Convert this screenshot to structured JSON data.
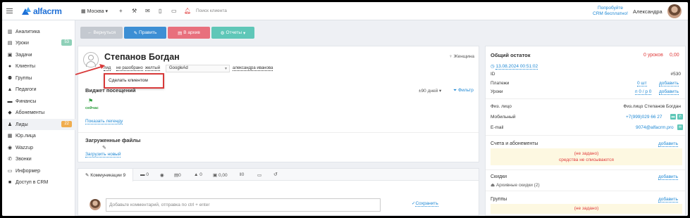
{
  "topbar": {
    "branch": "Москва",
    "search_placeholder": "Поиск клиента",
    "promo_line1": "Попробуйте",
    "promo_line2": "CRM бесплатно!",
    "user": "Александра"
  },
  "brand": {
    "name": "alfacrm",
    "accent": "#1e6fd6"
  },
  "sidebar": {
    "items": [
      {
        "icon": "chart-icon",
        "label": "Аналитика",
        "badge": ""
      },
      {
        "icon": "calendar-icon",
        "label": "Уроки",
        "badge": "53"
      },
      {
        "icon": "tasks-icon",
        "label": "Задачи",
        "badge": ""
      },
      {
        "icon": "user-icon",
        "label": "Клиенты",
        "badge": ""
      },
      {
        "icon": "group-icon",
        "label": "Группы",
        "badge": ""
      },
      {
        "icon": "graduation-cap-icon",
        "label": "Педагоги",
        "badge": ""
      },
      {
        "icon": "money-icon",
        "label": "Финансы",
        "badge": ""
      },
      {
        "icon": "tag-icon",
        "label": "Абонементы",
        "badge": ""
      },
      {
        "icon": "user-plus-icon",
        "label": "Лиды",
        "badge": "22"
      },
      {
        "icon": "building-icon",
        "label": "Юр.лица",
        "badge": ""
      },
      {
        "icon": "whatsapp-icon",
        "label": "Wazzup",
        "badge": ""
      },
      {
        "icon": "phone-icon",
        "label": "Звонки",
        "badge": ""
      },
      {
        "icon": "monitor-icon",
        "label": "Информер",
        "badge": ""
      },
      {
        "icon": "lock-icon",
        "label": "Доступ в CRM",
        "badge": ""
      }
    ]
  },
  "actions": {
    "back": "Вернуться",
    "edit": "Править",
    "archive": "В архив",
    "reports": "Отчеты"
  },
  "profile": {
    "name": "Степанов Богдан",
    "gender": "Женщина",
    "tag1": "лид",
    "tag2": "не разобрано",
    "tag3": "желтый",
    "source": "GoogleAd",
    "manager": "александра иванова",
    "dropdown_item": "Сделать клиентом"
  },
  "widget": {
    "title": "Виджет посещений",
    "days": "±90 дней",
    "filter": "Фильтр",
    "now": "сейчас",
    "legend": "Показать легенду"
  },
  "files": {
    "title": "Загруженные файлы",
    "upload": "Загрузить новый"
  },
  "tabs": [
    {
      "icon": "comments-icon",
      "label": "Коммуникации 9"
    },
    {
      "icon": "message-icon",
      "label": "0"
    },
    {
      "icon": "whatsapp-icon",
      "label": ""
    },
    {
      "icon": "document-icon",
      "label": "0"
    },
    {
      "icon": "shopping-bag-icon",
      "label": "0"
    },
    {
      "icon": "wallet-icon",
      "label": "0,00"
    },
    {
      "icon": "pause-icon",
      "label": "0"
    },
    {
      "icon": "ticket-icon",
      "label": ""
    },
    {
      "icon": "history-icon",
      "label": ""
    }
  ],
  "comment": {
    "placeholder": "Добавьте комментарий, отправка по ctrl + enter",
    "save": "Сохранить"
  },
  "balance": {
    "title": "Общий остаток",
    "lessons": "0 уроков",
    "amount": "0,00",
    "date": "13.08.2024 00:51:02",
    "id_label": "ID",
    "id_value": "#530",
    "payments_label": "Платежи",
    "payments_value": "0 шт",
    "payments_add": "добавить",
    "lessons_label": "Уроки",
    "lessons_value": "п 0 / р 0",
    "lessons_add": "добавить"
  },
  "contacts": {
    "person_label": "Физ. лицо",
    "person_value": "Физ.лицо Степанов Богдан",
    "phone_label": "Мобильный",
    "phone_value": "+7(999)029 66 27",
    "email_label": "E-mail",
    "email_value": "9074@alfacrm.pro"
  },
  "accounts": {
    "title": "Счета и абонементы",
    "add": "добавить",
    "empty": "(не задано)",
    "note": "средства не списываются"
  },
  "discounts": {
    "title": "Скидки",
    "add": "добавить",
    "archive": "Архивные скидки (2)"
  },
  "groups": {
    "title": "Группы",
    "add": "добавить",
    "empty": "(не задано)"
  }
}
